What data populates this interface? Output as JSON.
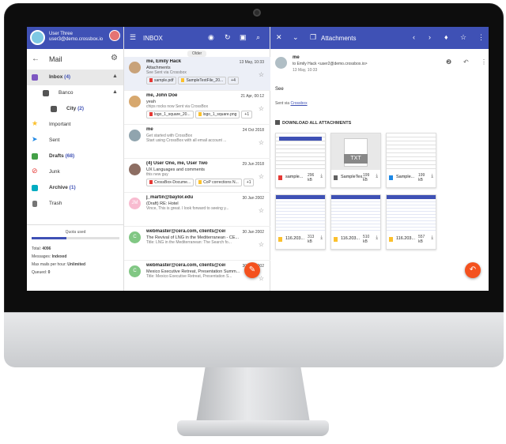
{
  "user": {
    "name": "User Three",
    "email": "user3@demo.crossbox.io"
  },
  "left": {
    "title": "Mail",
    "nav": [
      {
        "label": "Inbox",
        "count": "(4)",
        "color": "#7e57c2"
      },
      {
        "label": "Banco",
        "count": "",
        "color": "#555555"
      },
      {
        "label": "City",
        "count": "(2)",
        "color": "#555555"
      },
      {
        "label": "Important",
        "count": "",
        "color": "#fbc02d"
      },
      {
        "label": "Sent",
        "count": "",
        "color": "#1e88e5"
      },
      {
        "label": "Drafts",
        "count": "(68)",
        "color": "#43a047"
      },
      {
        "label": "Junk",
        "count": "",
        "color": "#e53935"
      },
      {
        "label": "Archive",
        "count": "(1)",
        "color": "#00acc1"
      },
      {
        "label": "Trash",
        "count": "",
        "color": "#757575"
      }
    ],
    "quota": {
      "label": "Quota used",
      "used_fraction": 0.4,
      "total_label": "Total:",
      "total": "4096",
      "messages_label": "Messages:",
      "messages": "Indexed",
      "max_label": "Max mails per hour:",
      "max": "Unlimited",
      "queued_label": "Queued:",
      "queued": "0"
    }
  },
  "middle": {
    "title": "INBOX",
    "today_label": "Older",
    "threads": [
      {
        "from": "me, Emily Hack",
        "date": "13 May, 10:33",
        "subject": "Attachments",
        "preview": "See Sent via Crossbox",
        "chips": [
          "sample.pdf",
          "SampleTextFile_20...",
          "+4"
        ],
        "avatar": "#c8a27a"
      },
      {
        "from": "me, John Doe",
        "date": "21 Apr, 00:12",
        "subject": "yeah",
        "preview": "chips rocks now Sent via CrossBox",
        "chips": [
          "logo_1_square_20...",
          "logo_1_square.png",
          "+1"
        ],
        "avatar": "#d7a86e"
      },
      {
        "from": "me",
        "date": "24 Oct 2018",
        "subject": "",
        "preview": "Get started with CrossBox",
        "preview2": "Start using CrossBox with all email account ...",
        "chips": [],
        "avatar": "#90a4ae"
      },
      {
        "from": "(4) User One, me, User Two",
        "date": "29 Jun 2018",
        "subject": "UX Languages and comments",
        "preview": "this new guy",
        "chips": [
          "CrossBox-Docume...",
          "CoP corrections N...",
          "+1"
        ],
        "avatar": "#8d6e63"
      },
      {
        "from": "j_martin@baylor.edu",
        "date": "30 Jan 2002",
        "subject": "(Draft) RE: Hotel",
        "preview": "Vince, This is great. I look forward to seeing y...",
        "chips": [],
        "avatar": "#f8bbd0",
        "initial": "JM"
      },
      {
        "from": "webmaster@cera.com, clients@cer...",
        "date": "30 Jan 2002",
        "subject": "The Revival of LNG in the Mediterranean - CE...",
        "preview": "Title: LNG in the Mediterranean: The Search fo...",
        "chips": [],
        "avatar": "#81c784",
        "initial": "C"
      },
      {
        "from": "webmaster@cera.com, clients@cer...",
        "date": "30 Jan 2002",
        "subject": "Mexico Executive Retreat, Presentation Summ...",
        "preview": "Title: Mexico Executive Retreat, Presentation S...",
        "chips": [],
        "avatar": "#81c784",
        "initial": "C"
      }
    ]
  },
  "right": {
    "title": "Attachments",
    "from": "me",
    "to": "to Emily Hack <user2@demo.crossbox.io>",
    "date": "13 May, 10:33",
    "body": "See",
    "sent_via": "Sent via",
    "sent_via_link": "Crossbox",
    "download_all": "DOWNLOAD ALL ATTACHMENTS",
    "attachments": [
      {
        "name": "sample...",
        "size": "296 kB",
        "type_color": "#e53935",
        "thumb": "pdf"
      },
      {
        "name": "SampleTex...",
        "size": "199 kB",
        "type_color": "#616161",
        "thumb": "txt",
        "thumb_label": "TXT"
      },
      {
        "name": "Sample...",
        "size": "199 kB",
        "type_color": "#1e88e5",
        "thumb": "doc"
      },
      {
        "name": "116.203...",
        "size": "313 kB",
        "type_color": "#fbc02d",
        "thumb": "sheet"
      },
      {
        "name": "116.203...",
        "size": "510 kB",
        "type_color": "#fbc02d",
        "thumb": "sheet"
      },
      {
        "name": "116.203...",
        "size": "557 kB",
        "type_color": "#fbc02d",
        "thumb": "sheet"
      }
    ]
  }
}
